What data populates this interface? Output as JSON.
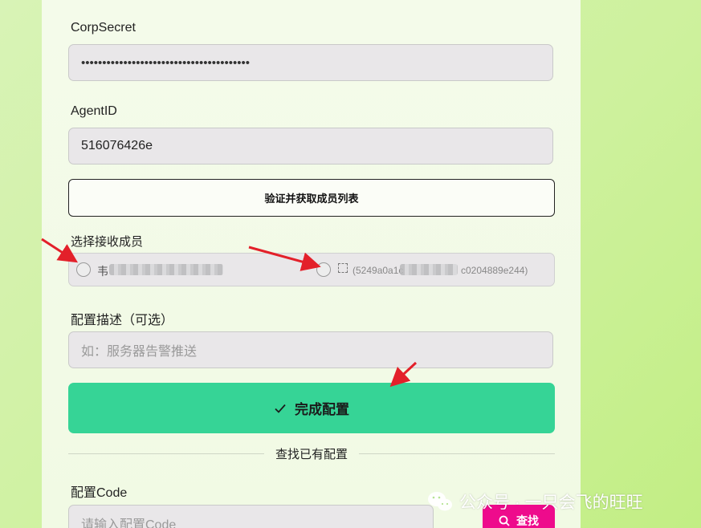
{
  "form": {
    "corp_secret_label": "CorpSecret",
    "corp_secret_value": "••••••••••••••••••••••••••••••••••••••••",
    "agent_id_label": "AgentID",
    "agent_id_value": "516076426e",
    "verify_button": "验证并获取成员列表",
    "members_label": "选择接收成员",
    "members": [
      {
        "name_prefix": "韦",
        "checked": false
      },
      {
        "name_prefix": "(5249a0a1c",
        "name_suffix": "c0204889e244)",
        "checked": false
      }
    ],
    "description_label": "配置描述（可选）",
    "description_placeholder": "如：服务器告警推送",
    "complete_button": "完成配置",
    "divider_text": "查找已有配置",
    "config_code_label": "配置Code",
    "config_code_placeholder": "请输入配置Code",
    "search_button": "查找"
  },
  "watermark": {
    "text": "公众号 · 一只会飞的旺旺"
  },
  "colors": {
    "primary": "#36d496",
    "search": "#ee0b8c",
    "annotation_arrow": "#e3202a"
  }
}
